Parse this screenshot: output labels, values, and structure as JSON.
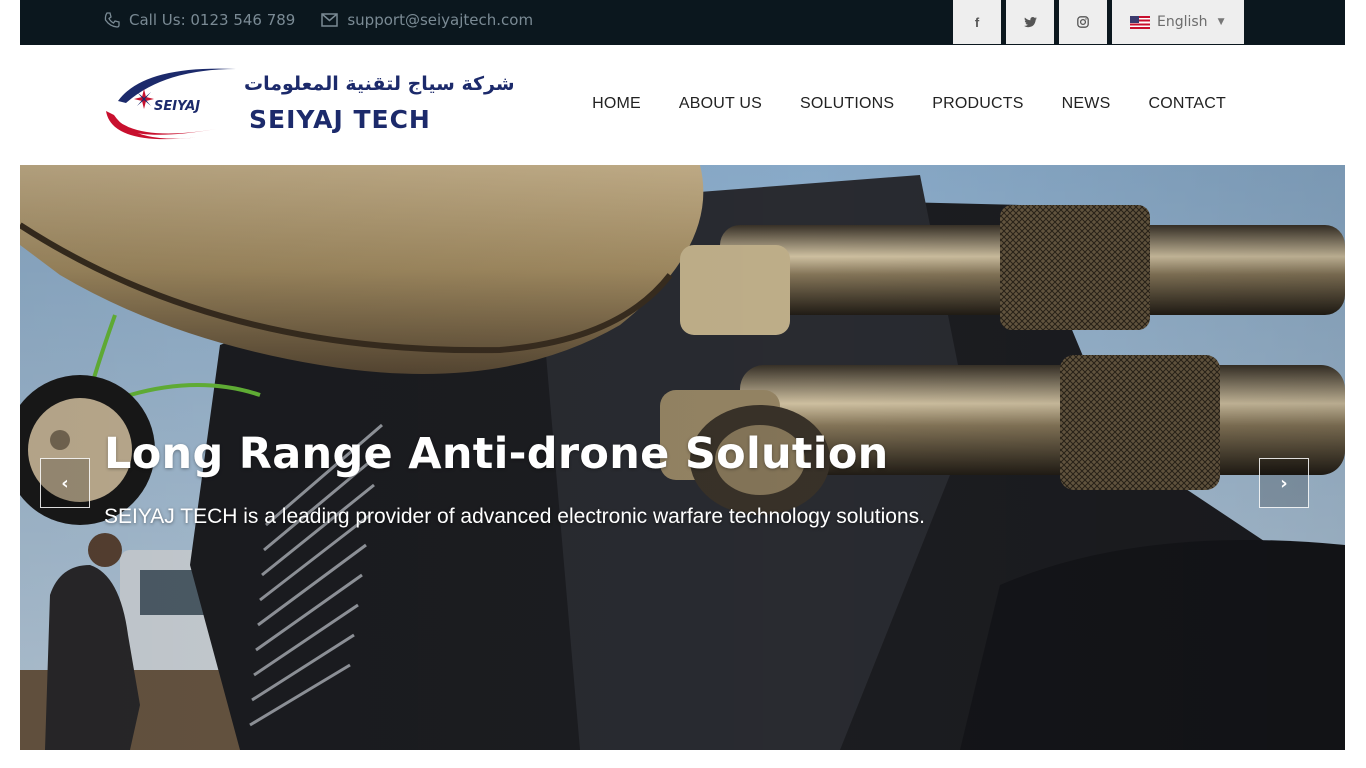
{
  "topbar": {
    "phone_text": "Call Us: 0123 546 789",
    "email_text": "support@seiyajtech.com",
    "social": [
      {
        "icon": "facebook-icon",
        "glyph": "f"
      },
      {
        "icon": "twitter-icon",
        "glyph": "t"
      },
      {
        "icon": "instagram-icon",
        "glyph": "◎"
      }
    ],
    "language": "English"
  },
  "logo": {
    "arabic_text": "شركة سياج لتقنية المعلومات",
    "brand_text": "SEIYAJ TECH",
    "emblem_text": "SEIYAJ"
  },
  "nav": {
    "items": [
      "HOME",
      "ABOUT US",
      "SOLUTIONS",
      "PRODUCTS",
      "NEWS",
      "CONTACT"
    ]
  },
  "hero": {
    "title": "Long Range Anti-drone Solution",
    "subtitle": "SEIYAJ TECH is a leading provider of advanced electronic warfare technology solutions.",
    "prev_glyph": "‹",
    "next_glyph": "›"
  },
  "colors": {
    "topbar_bg": "#0b171e",
    "brand_navy": "#1c2a6b",
    "brand_red": "#c8102e",
    "nav_text": "#222222"
  }
}
